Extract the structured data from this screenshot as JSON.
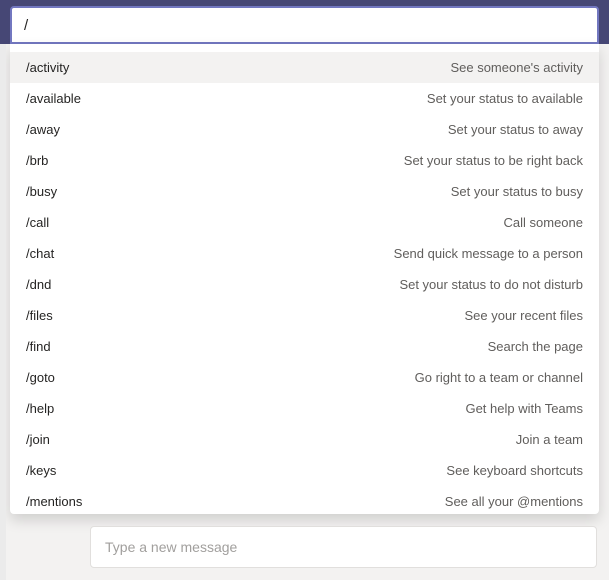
{
  "search": {
    "value": "/"
  },
  "commands": [
    {
      "name": "/activity",
      "desc": "See someone's activity",
      "selected": true
    },
    {
      "name": "/available",
      "desc": "Set your status to available",
      "selected": false
    },
    {
      "name": "/away",
      "desc": "Set your status to away",
      "selected": false
    },
    {
      "name": "/brb",
      "desc": "Set your status to be right back",
      "selected": false
    },
    {
      "name": "/busy",
      "desc": "Set your status to busy",
      "selected": false
    },
    {
      "name": "/call",
      "desc": "Call someone",
      "selected": false
    },
    {
      "name": "/chat",
      "desc": "Send quick message to a person",
      "selected": false
    },
    {
      "name": "/dnd",
      "desc": "Set your status to do not disturb",
      "selected": false
    },
    {
      "name": "/files",
      "desc": "See your recent files",
      "selected": false
    },
    {
      "name": "/find",
      "desc": "Search the page",
      "selected": false
    },
    {
      "name": "/goto",
      "desc": "Go right to a team or channel",
      "selected": false
    },
    {
      "name": "/help",
      "desc": "Get help with Teams",
      "selected": false
    },
    {
      "name": "/join",
      "desc": "Join a team",
      "selected": false
    },
    {
      "name": "/keys",
      "desc": "See keyboard shortcuts",
      "selected": false
    },
    {
      "name": "/mentions",
      "desc": "See all your @mentions",
      "selected": false
    }
  ],
  "compose": {
    "placeholder": "Type a new message"
  }
}
